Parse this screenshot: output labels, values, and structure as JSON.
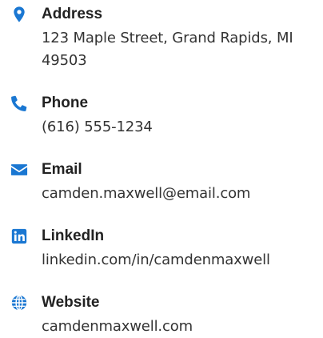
{
  "accent_color": "#1a77d2",
  "contact": {
    "items": [
      {
        "icon": "map-pin-icon",
        "label": "Address",
        "value": "123 Maple Street, Grand Rapids, MI 49503"
      },
      {
        "icon": "phone-icon",
        "label": "Phone",
        "value": "(616) 555-1234"
      },
      {
        "icon": "envelope-icon",
        "label": "Email",
        "value": "camden.maxwell@email.com"
      },
      {
        "icon": "linkedin-icon",
        "label": "LinkedIn",
        "value": "linkedin.com/in/camdenmaxwell"
      },
      {
        "icon": "globe-icon",
        "label": "Website",
        "value": "camdenmaxwell.com"
      }
    ]
  }
}
